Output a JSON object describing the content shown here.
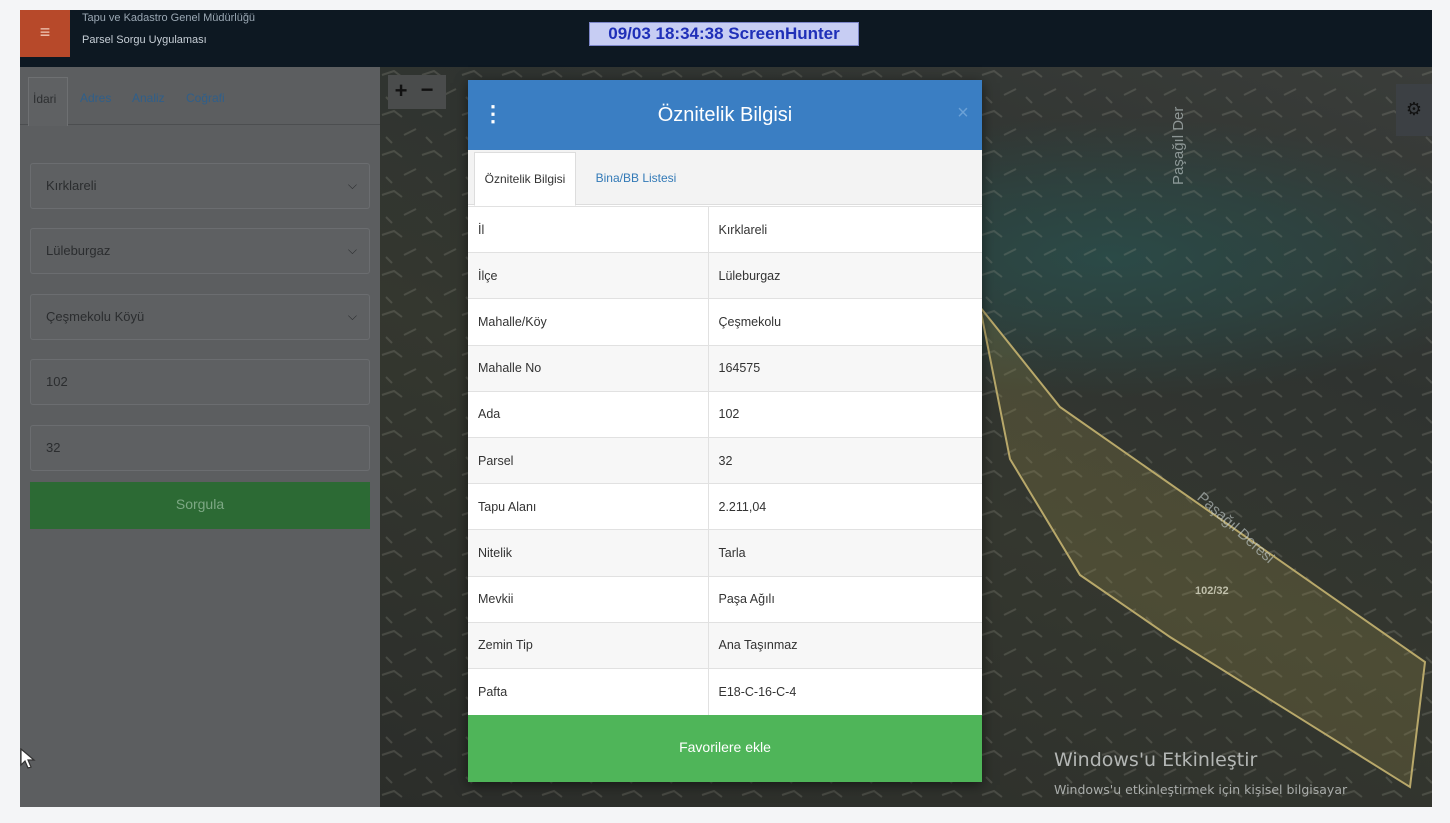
{
  "header": {
    "org_name": "Tapu ve Kadastro Genel Müdürlüğü",
    "app_name": "Parsel Sorgu Uygulaması",
    "menu_icon": "hamburger-icon",
    "overlay_stamp": "09/03  18:34:38  ScreenHunter"
  },
  "sidebar": {
    "tabs": [
      "İdari",
      "Adres",
      "Analiz",
      "Coğrafi"
    ],
    "active_tab": "İdari",
    "fields": {
      "il": "Kırklareli",
      "ilce": "Lüleburgaz",
      "mahalle": "Çeşmekolu Köyü",
      "ada": "102",
      "parsel": "32"
    },
    "query_button": "Sorgula"
  },
  "map": {
    "zoom_in": "+",
    "zoom_out": "−",
    "settings_icon": "gear-icon",
    "street_label_1": "Paşağıl Der",
    "street_label_2": "Paşağıl Deresi",
    "parcel_label": "102/32",
    "windows_watermark_title": "Windows'u Etkinleştir",
    "windows_watermark_subtitle": "Windows'u etkinleştirmek için kişisel bilgisayar"
  },
  "modal": {
    "title": "Öznitelik Bilgisi",
    "menu_icon": "kebab-icon",
    "close_label": "×",
    "tabs": [
      "Öznitelik Bilgisi",
      "Bina/BB Listesi"
    ],
    "active_tab": "Öznitelik Bilgisi",
    "rows": [
      {
        "key": "İl",
        "value": "Kırklareli"
      },
      {
        "key": "İlçe",
        "value": "Lüleburgaz"
      },
      {
        "key": "Mahalle/Köy",
        "value": "Çeşmekolu"
      },
      {
        "key": "Mahalle No",
        "value": "164575"
      },
      {
        "key": "Ada",
        "value": "102"
      },
      {
        "key": "Parsel",
        "value": "32"
      },
      {
        "key": "Tapu Alanı",
        "value": "2.211,04"
      },
      {
        "key": "Nitelik",
        "value": "Tarla"
      },
      {
        "key": "Mevkii",
        "value": "Paşa Ağılı"
      },
      {
        "key": "Zemin Tip",
        "value": "Ana Taşınmaz"
      },
      {
        "key": "Pafta",
        "value": "E18-C-16-C-4"
      }
    ],
    "favorite_button": "Favorilere ekle"
  },
  "colors": {
    "header_bg": "#0d1822",
    "menu_btn_bg": "#b7492a",
    "modal_header": "#3a7ec3",
    "favorite_button": "#4fb559",
    "query_button": "#2c6a34",
    "parcel_outline": "#b8a86a"
  }
}
